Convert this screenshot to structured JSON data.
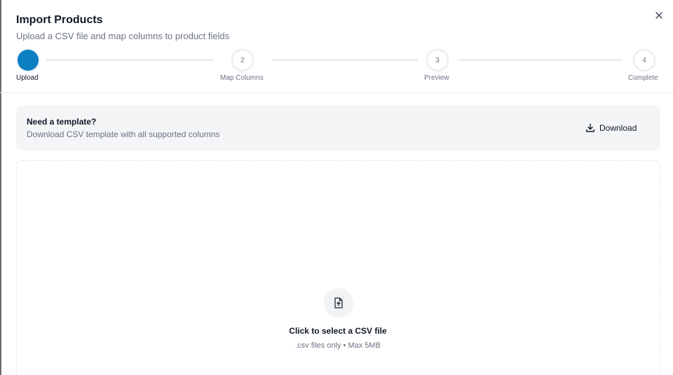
{
  "dialog": {
    "title": "Import Products",
    "subtitle": "Upload a CSV file and map columns to product fields",
    "close_icon": "close-icon"
  },
  "stepper": {
    "current_step": 1,
    "steps": [
      {
        "number": "",
        "label": "Upload",
        "state": "active"
      },
      {
        "number": "2",
        "label": "Map Columns",
        "state": "pending"
      },
      {
        "number": "3",
        "label": "Preview",
        "state": "pending"
      },
      {
        "number": "4",
        "label": "Complete",
        "state": "pending"
      }
    ]
  },
  "template": {
    "title": "Need a template?",
    "description": "Download CSV template with all supported columns",
    "download_label": "Download",
    "download_icon": "download-icon"
  },
  "dropzone": {
    "icon": "file-upload-icon",
    "title": "Click to select a CSV file",
    "hint": ".csv files only • Max 5MB"
  },
  "colors": {
    "accent": "#0b7fc0",
    "panel_bg": "#f4f5f7",
    "muted_text": "#6b7280"
  }
}
